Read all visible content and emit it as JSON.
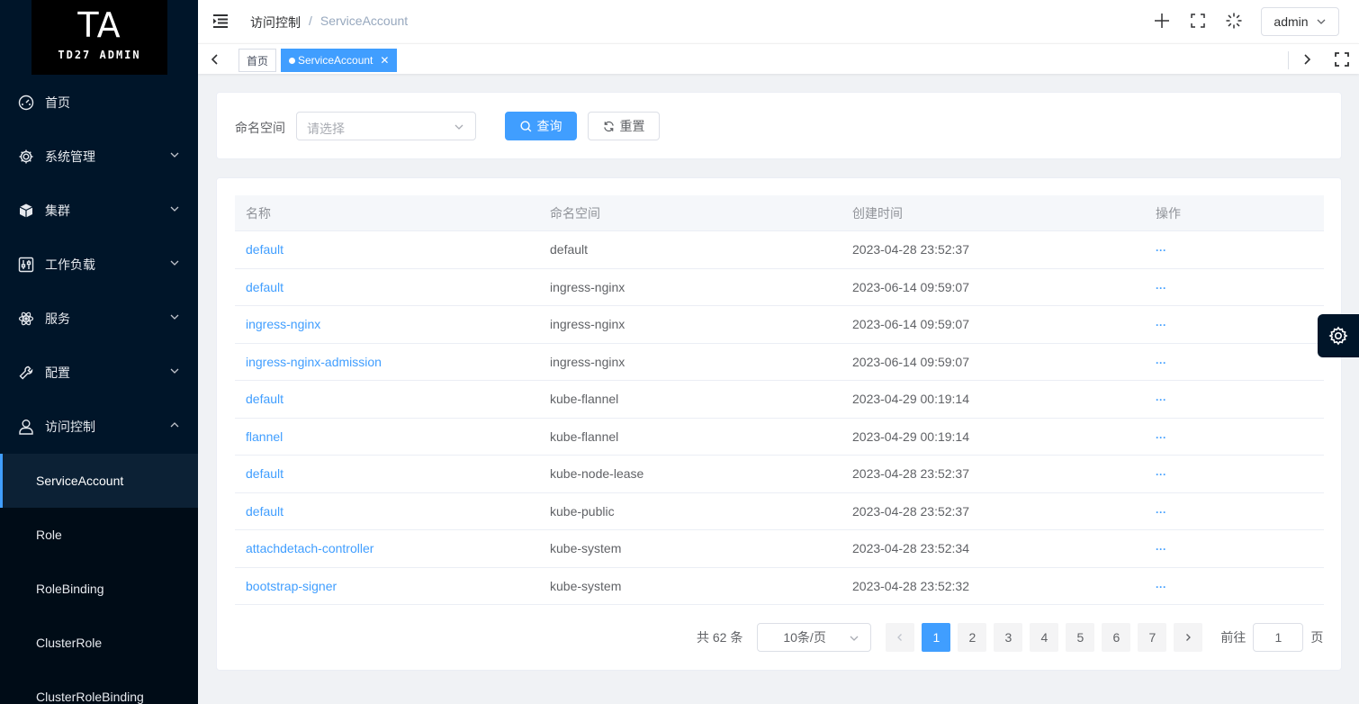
{
  "logo": {
    "big": "TA",
    "small": "TD27 ADMIN"
  },
  "sidebar": {
    "items": [
      {
        "label": "首页",
        "icon": "dashboard-icon",
        "expandable": false
      },
      {
        "label": "系统管理",
        "icon": "gear-icon",
        "expandable": true
      },
      {
        "label": "集群",
        "icon": "cube-icon",
        "expandable": true
      },
      {
        "label": "工作负载",
        "icon": "sliders-icon",
        "expandable": true
      },
      {
        "label": "服务",
        "icon": "atom-icon",
        "expandable": true
      },
      {
        "label": "配置",
        "icon": "wrench-icon",
        "expandable": true
      },
      {
        "label": "访问控制",
        "icon": "user-icon",
        "expandable": true,
        "expanded": true
      }
    ],
    "sub_items": [
      {
        "label": "ServiceAccount",
        "active": true
      },
      {
        "label": "Role"
      },
      {
        "label": "RoleBinding"
      },
      {
        "label": "ClusterRole"
      },
      {
        "label": "ClusterRoleBinding"
      }
    ]
  },
  "header": {
    "breadcrumb": [
      "访问控制",
      "ServiceAccount"
    ],
    "breadcrumb_sep": "/",
    "user": "admin"
  },
  "tabs": [
    {
      "label": "首页",
      "active": false
    },
    {
      "label": "ServiceAccount",
      "active": true
    }
  ],
  "search": {
    "namespace_label": "命名空间",
    "namespace_placeholder": "请选择",
    "query_label": "查询",
    "reset_label": "重置"
  },
  "table": {
    "columns": [
      "名称",
      "命名空间",
      "创建时间",
      "操作"
    ],
    "rows": [
      {
        "name": "default",
        "namespace": "default",
        "created": "2023-04-28 23:52:37"
      },
      {
        "name": "default",
        "namespace": "ingress-nginx",
        "created": "2023-06-14 09:59:07"
      },
      {
        "name": "ingress-nginx",
        "namespace": "ingress-nginx",
        "created": "2023-06-14 09:59:07"
      },
      {
        "name": "ingress-nginx-admission",
        "namespace": "ingress-nginx",
        "created": "2023-06-14 09:59:07"
      },
      {
        "name": "default",
        "namespace": "kube-flannel",
        "created": "2023-04-29 00:19:14"
      },
      {
        "name": "flannel",
        "namespace": "kube-flannel",
        "created": "2023-04-29 00:19:14"
      },
      {
        "name": "default",
        "namespace": "kube-node-lease",
        "created": "2023-04-28 23:52:37"
      },
      {
        "name": "default",
        "namespace": "kube-public",
        "created": "2023-04-28 23:52:37"
      },
      {
        "name": "attachdetach-controller",
        "namespace": "kube-system",
        "created": "2023-04-28 23:52:34"
      },
      {
        "name": "bootstrap-signer",
        "namespace": "kube-system",
        "created": "2023-04-28 23:52:32"
      }
    ],
    "action_text": "···"
  },
  "pagination": {
    "total": "共 62 条",
    "page_size": "10条/页",
    "pages": [
      "1",
      "2",
      "3",
      "4",
      "5",
      "6",
      "7"
    ],
    "current_page": "1",
    "goto_label": "前往",
    "goto_value": "1",
    "goto_suffix": "页"
  },
  "colors": {
    "primary": "#409eff",
    "sidebar_bg": "#001529"
  }
}
